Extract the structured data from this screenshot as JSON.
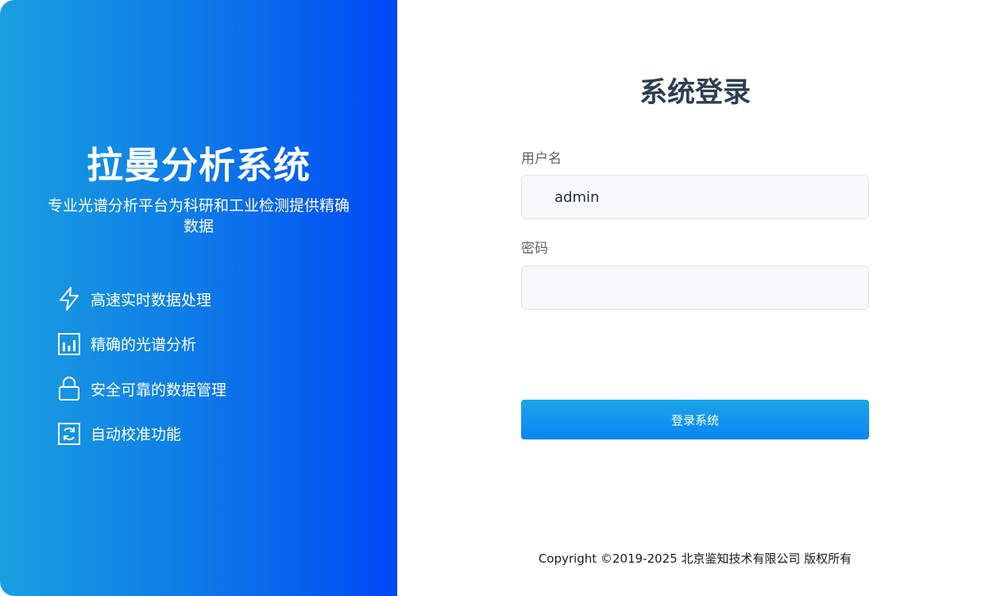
{
  "brand": {
    "title": "拉曼分析系统",
    "subtitle": "专业光谱分析平台为科研和工业检测提供精确数据"
  },
  "features": [
    {
      "icon": "lightning-icon",
      "label": "高速实时数据处理"
    },
    {
      "icon": "bar-chart-icon",
      "label": "精确的光谱分析"
    },
    {
      "icon": "lock-icon",
      "label": "安全可靠的数据管理"
    },
    {
      "icon": "refresh-icon",
      "label": "自动校准功能"
    }
  ],
  "login": {
    "title": "系统登录",
    "username_label": "用户名",
    "username_value": "admin",
    "password_label": "密码",
    "password_value": "",
    "submit_label": "登录系统"
  },
  "footer": {
    "copyright": "Copyright ©2019-2025 北京鉴知技术有限公司 版权所有"
  },
  "colors": {
    "gradient_start": "#1aa0df",
    "gradient_end": "#0048f5",
    "button": "#0a85f7",
    "title": "#2c3e50"
  }
}
